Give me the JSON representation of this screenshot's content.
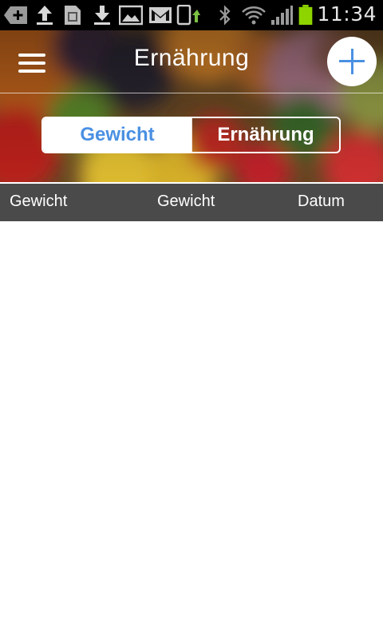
{
  "status_bar": {
    "time": "11:34",
    "icons": [
      "add-notification-icon",
      "upload-icon",
      "sim-card-icon",
      "download-icon",
      "gallery-icon",
      "gmail-icon",
      "phone-sync-icon",
      "bluetooth-icon",
      "wifi-icon",
      "signal-icon",
      "battery-icon"
    ],
    "battery_color": "#8ed400"
  },
  "header": {
    "title": "Ernährung",
    "accent_color": "#4a90e2"
  },
  "segmented_control": {
    "options": [
      {
        "label": "Gewicht",
        "selected": true
      },
      {
        "label": "Ernährung",
        "selected": false
      }
    ]
  },
  "table": {
    "columns": [
      "Gewicht",
      "Gewicht",
      "Datum"
    ],
    "rows": []
  }
}
